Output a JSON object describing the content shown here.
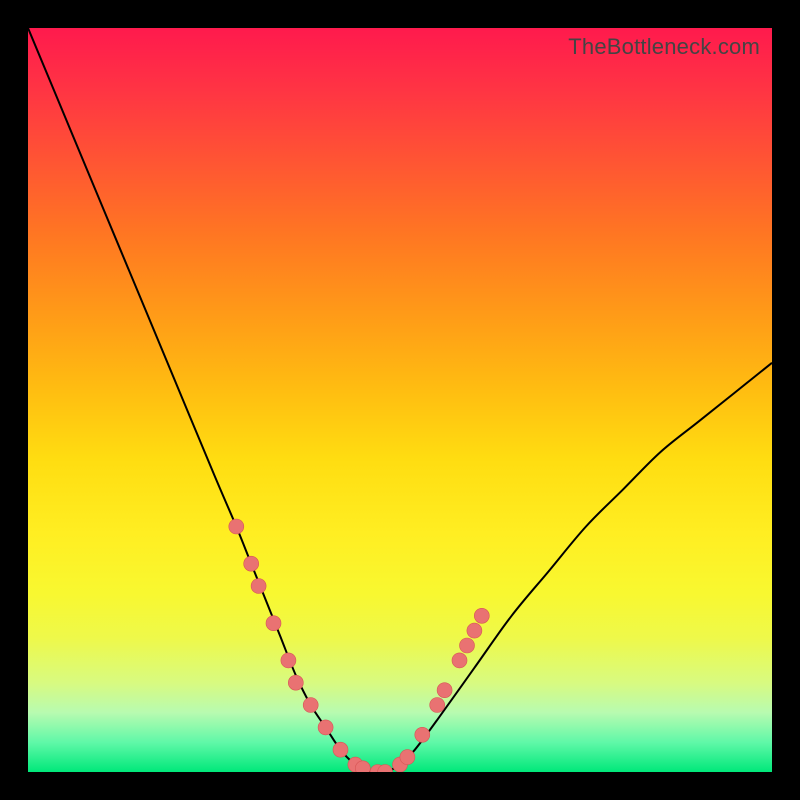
{
  "watermark": "TheBottleneck.com",
  "colors": {
    "background": "#000000",
    "gradient_top": "#ff1a4d",
    "gradient_bottom": "#00e87a",
    "curve": "#000000",
    "dot_fill": "#e97272",
    "dot_stroke": "#d85555"
  },
  "chart_data": {
    "type": "line",
    "title": "",
    "xlabel": "",
    "ylabel": "",
    "xlim": [
      0,
      100
    ],
    "ylim": [
      0,
      100
    ],
    "grid": false,
    "legend": false,
    "series": [
      {
        "name": "bottleneck-curve",
        "x": [
          0,
          5,
          10,
          15,
          20,
          25,
          28,
          30,
          32,
          34,
          36,
          38,
          40,
          42,
          44,
          46,
          48,
          50,
          52,
          55,
          60,
          65,
          70,
          75,
          80,
          85,
          90,
          95,
          100
        ],
        "y": [
          100,
          88,
          76,
          64,
          52,
          40,
          33,
          28,
          23,
          18,
          13,
          9,
          6,
          3,
          1,
          0,
          0,
          1,
          3,
          7,
          14,
          21,
          27,
          33,
          38,
          43,
          47,
          51,
          55
        ]
      }
    ],
    "markers": [
      {
        "x": 28,
        "y": 33
      },
      {
        "x": 30,
        "y": 28
      },
      {
        "x": 31,
        "y": 25
      },
      {
        "x": 33,
        "y": 20
      },
      {
        "x": 35,
        "y": 15
      },
      {
        "x": 36,
        "y": 12
      },
      {
        "x": 38,
        "y": 9
      },
      {
        "x": 40,
        "y": 6
      },
      {
        "x": 42,
        "y": 3
      },
      {
        "x": 44,
        "y": 1
      },
      {
        "x": 45,
        "y": 0.5
      },
      {
        "x": 47,
        "y": 0
      },
      {
        "x": 48,
        "y": 0
      },
      {
        "x": 50,
        "y": 1
      },
      {
        "x": 51,
        "y": 2
      },
      {
        "x": 53,
        "y": 5
      },
      {
        "x": 55,
        "y": 9
      },
      {
        "x": 56,
        "y": 11
      },
      {
        "x": 58,
        "y": 15
      },
      {
        "x": 59,
        "y": 17
      },
      {
        "x": 60,
        "y": 19
      },
      {
        "x": 61,
        "y": 21
      }
    ]
  }
}
